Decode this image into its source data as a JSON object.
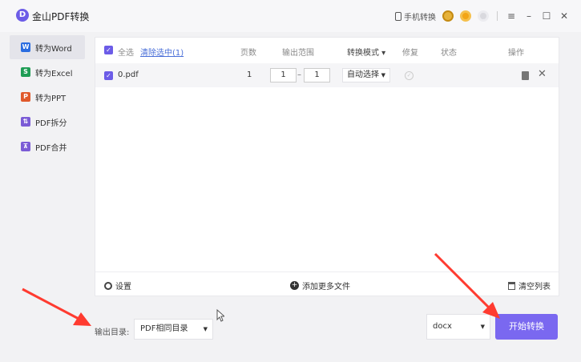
{
  "titlebar": {
    "logo_letter": "D",
    "title": "金山PDF转换",
    "mobile_convert": "手机转换",
    "controls": {
      "menu": "≡",
      "minimize": "–",
      "maximize": "☐",
      "close": "✕"
    }
  },
  "sidebar": {
    "items": [
      {
        "label": "转为Word",
        "icon_letter": "W",
        "icon_color": "#2b6de0",
        "active": true
      },
      {
        "label": "转为Excel",
        "icon_letter": "S",
        "icon_color": "#1f9d55"
      },
      {
        "label": "转为PPT",
        "icon_letter": "P",
        "icon_color": "#e0592b"
      },
      {
        "label": "PDF拆分",
        "icon_letter": "⇅",
        "icon_color": "#7b5cd6"
      },
      {
        "label": "PDF合并",
        "icon_letter": "⊼",
        "icon_color": "#7b5cd6"
      }
    ]
  },
  "table": {
    "select_all": "全选",
    "clear_selected": "清除选中(1)",
    "headers": {
      "pages": "页数",
      "range": "输出范围",
      "mode": "转换模式",
      "repair": "修复",
      "status": "状态",
      "actions": "操作"
    },
    "rows": [
      {
        "filename": "0.pdf",
        "pages": "1",
        "range_from": "1",
        "range_sep": "–",
        "range_to": "1",
        "mode": "自动选择"
      }
    ]
  },
  "footer": {
    "settings": "设置",
    "add_files": "添加更多文件",
    "clear_list": "清空列表"
  },
  "output": {
    "label": "输出目录:",
    "directory": "PDF相同目录",
    "format": "docx",
    "start": "开始转换"
  },
  "colors": {
    "accent": "#7a68f0",
    "arrow": "#ff3b30"
  }
}
